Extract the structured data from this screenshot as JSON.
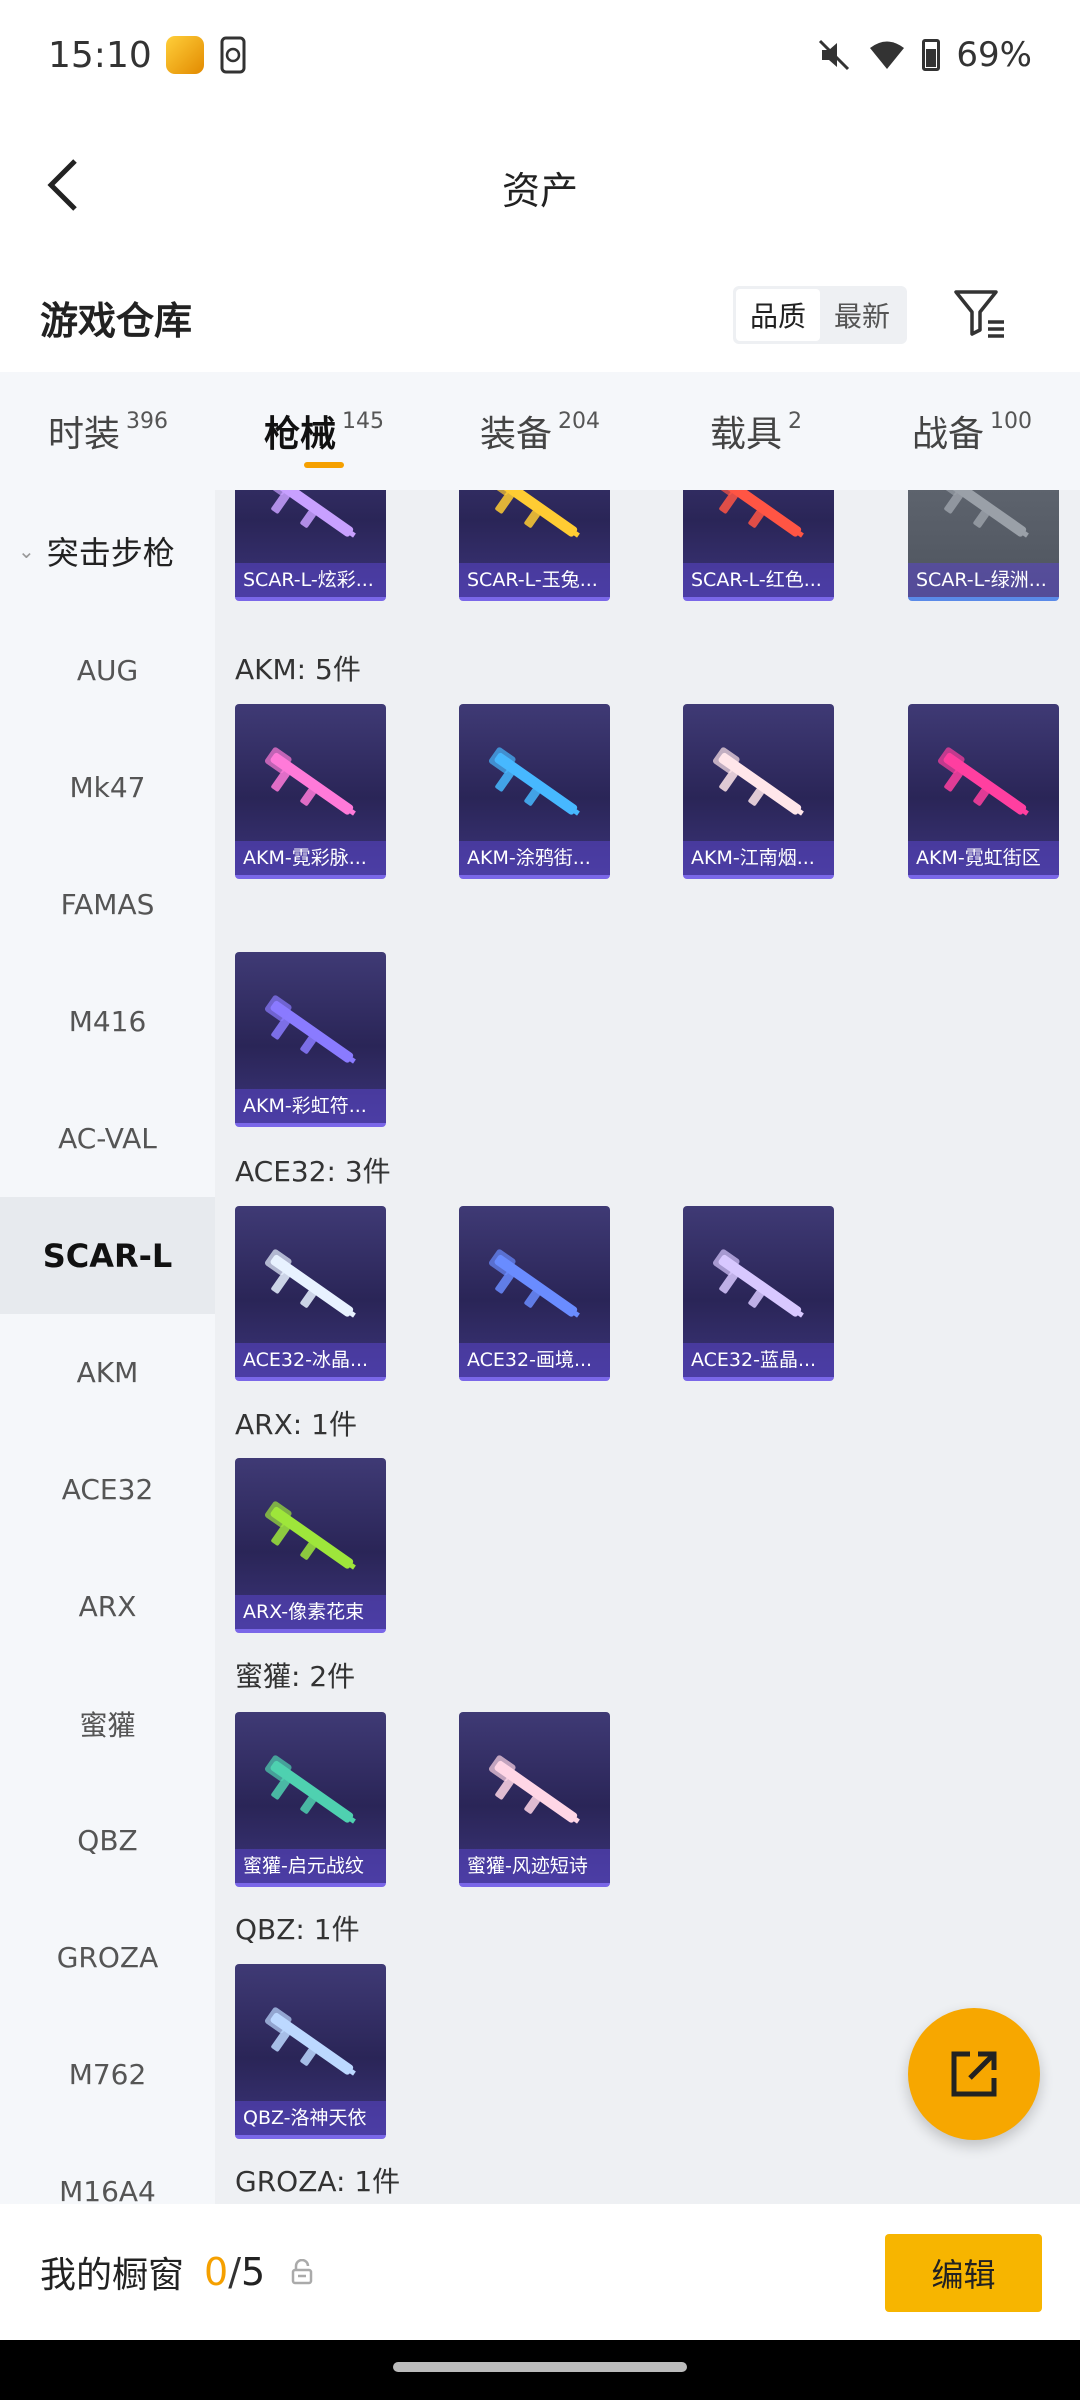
{
  "status_bar": {
    "time": "15:10",
    "battery": "69%"
  },
  "header": {
    "title": "资产"
  },
  "section": {
    "title": "游戏仓库",
    "sort_options": [
      "品质",
      "最新"
    ]
  },
  "tabs": [
    {
      "label": "时装",
      "count": "396"
    },
    {
      "label": "枪械",
      "count": "145"
    },
    {
      "label": "装备",
      "count": "204"
    },
    {
      "label": "载具",
      "count": "2"
    },
    {
      "label": "战备",
      "count": "100"
    }
  ],
  "sidebar": {
    "header": "突击步枪",
    "items": [
      "AUG",
      "Mk47",
      "FAMAS",
      "M416",
      "AC-VAL",
      "SCAR-L",
      "AKM",
      "ACE32",
      "ARX",
      "蜜獾",
      "QBZ",
      "GROZA",
      "M762",
      "M16A4"
    ]
  },
  "groups": [
    {
      "label": "",
      "items": [
        "SCAR-L-炫彩...",
        "SCAR-L-玉兔...",
        "SCAR-L-红色...",
        "SCAR-L-绿洲..."
      ]
    },
    {
      "label": "AKM: 5件",
      "items": [
        "AKM-霓彩脉...",
        "AKM-涂鸦街...",
        "AKM-江南烟...",
        "AKM-霓虹街区",
        "AKM-彩虹符..."
      ]
    },
    {
      "label": "ACE32: 3件",
      "items": [
        "ACE32-冰晶...",
        "ACE32-画境...",
        "ACE32-蓝晶..."
      ]
    },
    {
      "label": "ARX: 1件",
      "items": [
        "ARX-像素花束"
      ]
    },
    {
      "label": "蜜獾: 2件",
      "items": [
        "蜜獾-启元战纹",
        "蜜獾-风迹短诗"
      ]
    },
    {
      "label": "QBZ: 1件",
      "items": [
        "QBZ-洛神天依"
      ]
    },
    {
      "label": "GROZA: 1件",
      "items": []
    }
  ],
  "bottom": {
    "label": "我的橱窗",
    "count": "0",
    "total": "5",
    "edit": "编辑"
  }
}
